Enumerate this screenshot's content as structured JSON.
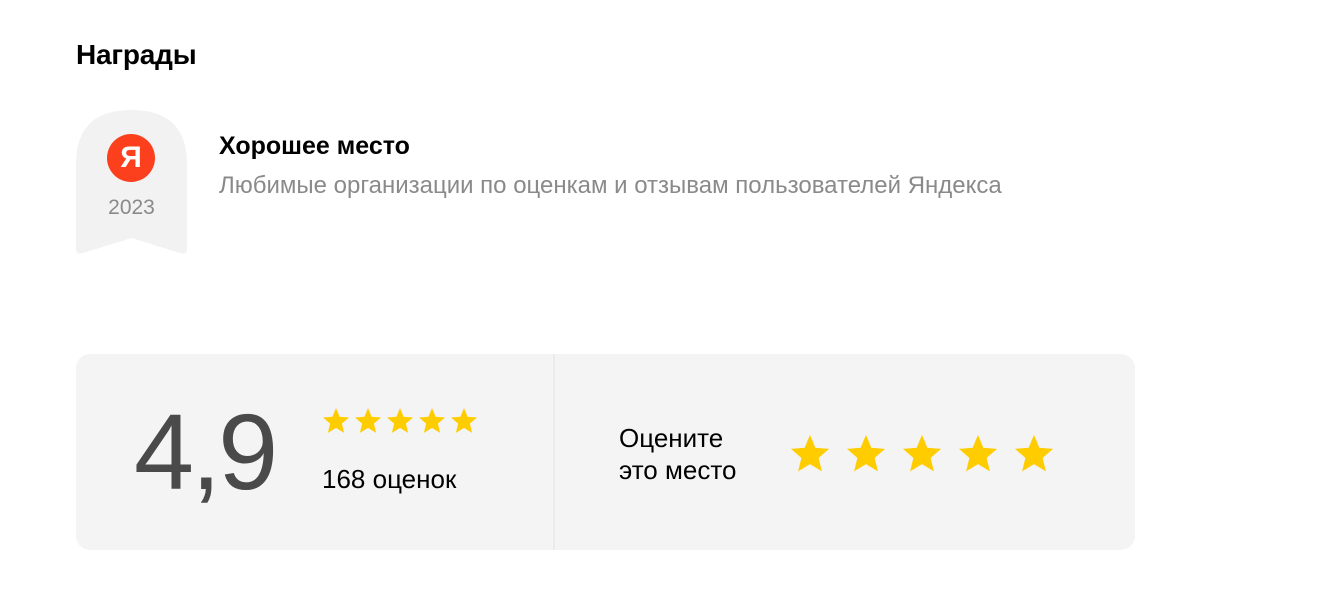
{
  "section": {
    "title": "Награды"
  },
  "award": {
    "logo_letter": "Я",
    "year": "2023",
    "title": "Хорошее место",
    "description": "Любимые организации по оценкам и отзывам пользователей Яндекса"
  },
  "rating": {
    "value": "4,9",
    "stars_filled": 5,
    "stars_total": 5,
    "count_label": "168 оценок"
  },
  "rate_prompt": {
    "line1": "Оцените",
    "line2": "это место",
    "stars_total": 5
  },
  "colors": {
    "star": "#ffcc00",
    "brand_red": "#fc3f1d",
    "card_bg": "#f4f4f4",
    "muted_text": "#8a8a8a",
    "rating_text": "#4a4a4a"
  }
}
